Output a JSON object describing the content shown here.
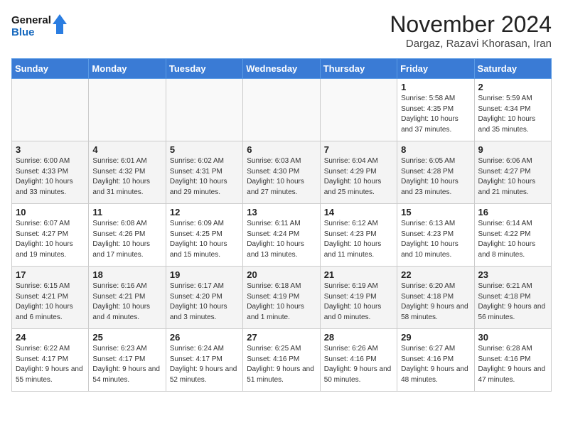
{
  "header": {
    "logo_line1": "General",
    "logo_line2": "Blue",
    "month_title": "November 2024",
    "location": "Dargaz, Razavi Khorasan, Iran"
  },
  "days_of_week": [
    "Sunday",
    "Monday",
    "Tuesday",
    "Wednesday",
    "Thursday",
    "Friday",
    "Saturday"
  ],
  "weeks": [
    [
      {
        "day": "",
        "info": ""
      },
      {
        "day": "",
        "info": ""
      },
      {
        "day": "",
        "info": ""
      },
      {
        "day": "",
        "info": ""
      },
      {
        "day": "",
        "info": ""
      },
      {
        "day": "1",
        "info": "Sunrise: 5:58 AM\nSunset: 4:35 PM\nDaylight: 10 hours and 37 minutes."
      },
      {
        "day": "2",
        "info": "Sunrise: 5:59 AM\nSunset: 4:34 PM\nDaylight: 10 hours and 35 minutes."
      }
    ],
    [
      {
        "day": "3",
        "info": "Sunrise: 6:00 AM\nSunset: 4:33 PM\nDaylight: 10 hours and 33 minutes."
      },
      {
        "day": "4",
        "info": "Sunrise: 6:01 AM\nSunset: 4:32 PM\nDaylight: 10 hours and 31 minutes."
      },
      {
        "day": "5",
        "info": "Sunrise: 6:02 AM\nSunset: 4:31 PM\nDaylight: 10 hours and 29 minutes."
      },
      {
        "day": "6",
        "info": "Sunrise: 6:03 AM\nSunset: 4:30 PM\nDaylight: 10 hours and 27 minutes."
      },
      {
        "day": "7",
        "info": "Sunrise: 6:04 AM\nSunset: 4:29 PM\nDaylight: 10 hours and 25 minutes."
      },
      {
        "day": "8",
        "info": "Sunrise: 6:05 AM\nSunset: 4:28 PM\nDaylight: 10 hours and 23 minutes."
      },
      {
        "day": "9",
        "info": "Sunrise: 6:06 AM\nSunset: 4:27 PM\nDaylight: 10 hours and 21 minutes."
      }
    ],
    [
      {
        "day": "10",
        "info": "Sunrise: 6:07 AM\nSunset: 4:27 PM\nDaylight: 10 hours and 19 minutes."
      },
      {
        "day": "11",
        "info": "Sunrise: 6:08 AM\nSunset: 4:26 PM\nDaylight: 10 hours and 17 minutes."
      },
      {
        "day": "12",
        "info": "Sunrise: 6:09 AM\nSunset: 4:25 PM\nDaylight: 10 hours and 15 minutes."
      },
      {
        "day": "13",
        "info": "Sunrise: 6:11 AM\nSunset: 4:24 PM\nDaylight: 10 hours and 13 minutes."
      },
      {
        "day": "14",
        "info": "Sunrise: 6:12 AM\nSunset: 4:23 PM\nDaylight: 10 hours and 11 minutes."
      },
      {
        "day": "15",
        "info": "Sunrise: 6:13 AM\nSunset: 4:23 PM\nDaylight: 10 hours and 10 minutes."
      },
      {
        "day": "16",
        "info": "Sunrise: 6:14 AM\nSunset: 4:22 PM\nDaylight: 10 hours and 8 minutes."
      }
    ],
    [
      {
        "day": "17",
        "info": "Sunrise: 6:15 AM\nSunset: 4:21 PM\nDaylight: 10 hours and 6 minutes."
      },
      {
        "day": "18",
        "info": "Sunrise: 6:16 AM\nSunset: 4:21 PM\nDaylight: 10 hours and 4 minutes."
      },
      {
        "day": "19",
        "info": "Sunrise: 6:17 AM\nSunset: 4:20 PM\nDaylight: 10 hours and 3 minutes."
      },
      {
        "day": "20",
        "info": "Sunrise: 6:18 AM\nSunset: 4:19 PM\nDaylight: 10 hours and 1 minute."
      },
      {
        "day": "21",
        "info": "Sunrise: 6:19 AM\nSunset: 4:19 PM\nDaylight: 10 hours and 0 minutes."
      },
      {
        "day": "22",
        "info": "Sunrise: 6:20 AM\nSunset: 4:18 PM\nDaylight: 9 hours and 58 minutes."
      },
      {
        "day": "23",
        "info": "Sunrise: 6:21 AM\nSunset: 4:18 PM\nDaylight: 9 hours and 56 minutes."
      }
    ],
    [
      {
        "day": "24",
        "info": "Sunrise: 6:22 AM\nSunset: 4:17 PM\nDaylight: 9 hours and 55 minutes."
      },
      {
        "day": "25",
        "info": "Sunrise: 6:23 AM\nSunset: 4:17 PM\nDaylight: 9 hours and 54 minutes."
      },
      {
        "day": "26",
        "info": "Sunrise: 6:24 AM\nSunset: 4:17 PM\nDaylight: 9 hours and 52 minutes."
      },
      {
        "day": "27",
        "info": "Sunrise: 6:25 AM\nSunset: 4:16 PM\nDaylight: 9 hours and 51 minutes."
      },
      {
        "day": "28",
        "info": "Sunrise: 6:26 AM\nSunset: 4:16 PM\nDaylight: 9 hours and 50 minutes."
      },
      {
        "day": "29",
        "info": "Sunrise: 6:27 AM\nSunset: 4:16 PM\nDaylight: 9 hours and 48 minutes."
      },
      {
        "day": "30",
        "info": "Sunrise: 6:28 AM\nSunset: 4:16 PM\nDaylight: 9 hours and 47 minutes."
      }
    ]
  ]
}
